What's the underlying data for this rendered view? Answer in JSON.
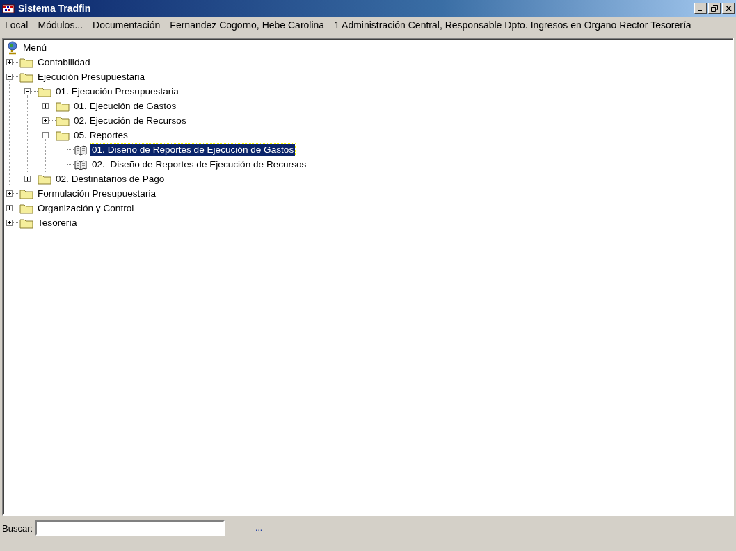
{
  "window": {
    "title": "Sistema Tradfin"
  },
  "menu": [
    "Local",
    "Módulos...",
    "Documentación",
    "Fernandez Cogorno, Hebe Carolina",
    "1 Administración Central, Responsable Dpto. Ingresos en Organo Rector Tesorería"
  ],
  "tree": {
    "label": "Menú",
    "kind": "root",
    "children": [
      {
        "label": "Contabilidad",
        "kind": "folder",
        "expanded": false,
        "selected": false
      },
      {
        "label": "Ejecución Presupuestaria",
        "kind": "folder",
        "expanded": true,
        "selected": false,
        "children": [
          {
            "label": "01. Ejecución Presupuestaria",
            "kind": "folder",
            "expanded": true,
            "selected": false,
            "children": [
              {
                "label": "01. Ejecución de Gastos",
                "kind": "folder",
                "expanded": false,
                "selected": false
              },
              {
                "label": "02. Ejecución de Recursos",
                "kind": "folder",
                "expanded": false,
                "selected": false
              },
              {
                "label": "05. Reportes",
                "kind": "folder",
                "expanded": true,
                "selected": false,
                "children": [
                  {
                    "label": "01. Diseño de Reportes de Ejecución de Gastos",
                    "kind": "book",
                    "selected": true
                  },
                  {
                    "label": "02.  Diseño de Reportes de Ejecución de Recursos",
                    "kind": "book",
                    "selected": false
                  }
                ]
              }
            ]
          },
          {
            "label": "02. Destinatarios de Pago",
            "kind": "folder",
            "expanded": false,
            "selected": false
          }
        ]
      },
      {
        "label": "Formulación Presupuestaria",
        "kind": "folder",
        "expanded": false,
        "selected": false
      },
      {
        "label": "Organización y Control",
        "kind": "folder",
        "expanded": false,
        "selected": false
      },
      {
        "label": "Tesorería",
        "kind": "folder",
        "expanded": false,
        "selected": false
      }
    ]
  },
  "search": {
    "label": "Buscar:",
    "more": "..."
  }
}
